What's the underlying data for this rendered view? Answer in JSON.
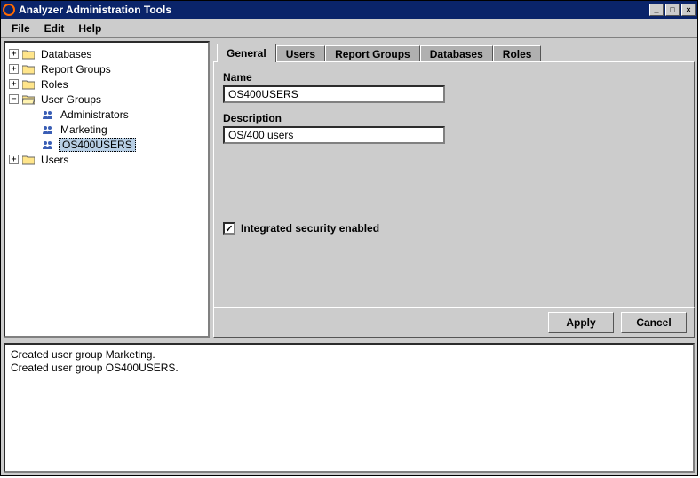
{
  "window": {
    "title": "Analyzer Administration Tools"
  },
  "menubar": {
    "file": "File",
    "edit": "Edit",
    "help": "Help"
  },
  "tree": {
    "databases": "Databases",
    "report_groups": "Report Groups",
    "roles": "Roles",
    "user_groups": "User Groups",
    "ug_children": {
      "administrators": "Administrators",
      "marketing": "Marketing",
      "os400users": "OS400USERS"
    },
    "users": "Users"
  },
  "tabs": {
    "general": "General",
    "users": "Users",
    "report_groups": "Report Groups",
    "databases": "Databases",
    "roles": "Roles"
  },
  "form": {
    "name_label": "Name",
    "name_value": "OS400USERS",
    "desc_label": "Description",
    "desc_value": "OS/400 users",
    "integrated_security": "Integrated security enabled",
    "integrated_security_checked": "✓"
  },
  "buttons": {
    "apply": "Apply",
    "cancel": "Cancel"
  },
  "log": {
    "line1": "Created user group Marketing.",
    "line2": "Created user group OS400USERS."
  }
}
